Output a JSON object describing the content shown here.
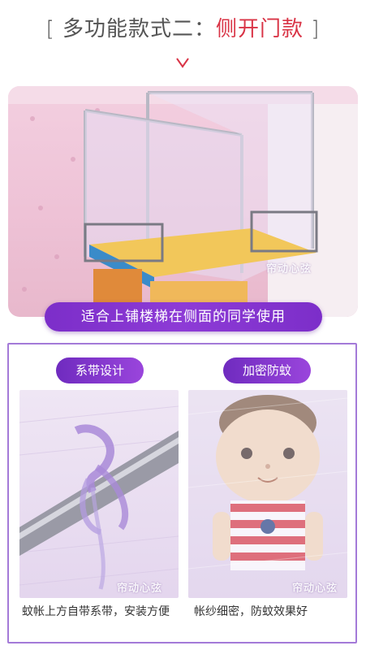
{
  "header": {
    "bracket_open": "[",
    "title_plain": " 多功能款式二：",
    "title_accent": "侧开门款",
    "bracket_close": " ]"
  },
  "hero": {
    "banner": "适合上铺楼梯在侧面的同学使用",
    "watermark": "帘动心弦"
  },
  "features": [
    {
      "label": "系带设计",
      "caption": "蚊帐上方自带系带，安装方便",
      "watermark": "帘动心弦"
    },
    {
      "label": "加密防蚊",
      "caption": "帐纱细密，防蚊效果好",
      "watermark": "帘动心弦"
    }
  ],
  "colors": {
    "accent": "#d93446",
    "purple": "#7c2ec9",
    "panel_border": "#a47ad8"
  }
}
